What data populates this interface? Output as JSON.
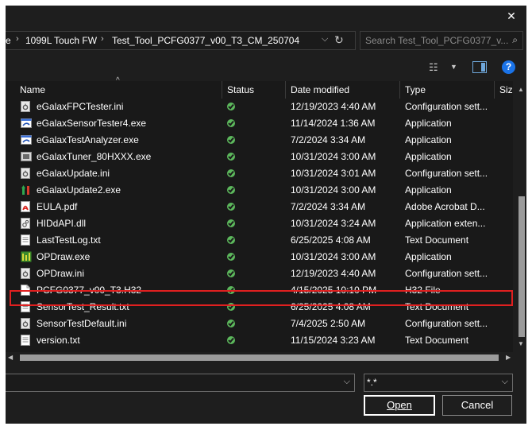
{
  "breadcrumb": [
    "e",
    "1099L Touch FW",
    "Test_Tool_PCFG0377_v00_T3_CM_250704"
  ],
  "search": {
    "placeholder": "Search Test_Tool_PCFG0377_v..."
  },
  "columns": {
    "name": "Name",
    "status": "Status",
    "date": "Date modified",
    "type": "Type",
    "size": "Siz"
  },
  "files": [
    {
      "name": "eGalaxFPCTester.ini",
      "date": "12/19/2023 4:40 AM",
      "type": "Configuration sett...",
      "icon": "ini-file-icon"
    },
    {
      "name": "eGalaxSensorTester4.exe",
      "date": "11/14/2024 1:36 AM",
      "type": "Application",
      "icon": "app-icon"
    },
    {
      "name": "eGalaxTestAnalyzer.exe",
      "date": "7/2/2024 3:34 AM",
      "type": "Application",
      "icon": "app-icon"
    },
    {
      "name": "eGalaxTuner_80HXXX.exe",
      "date": "10/31/2024 3:00 AM",
      "type": "Application",
      "icon": "tuner-app-icon"
    },
    {
      "name": "eGalaxUpdate.ini",
      "date": "10/31/2024 3:01 AM",
      "type": "Configuration sett...",
      "icon": "ini-file-icon"
    },
    {
      "name": "eGalaxUpdate2.exe",
      "date": "10/31/2024 3:00 AM",
      "type": "Application",
      "icon": "update-app-icon"
    },
    {
      "name": "EULA.pdf",
      "date": "7/2/2024 3:34 AM",
      "type": "Adobe Acrobat D...",
      "icon": "pdf-icon"
    },
    {
      "name": "HIDdAPI.dll",
      "date": "10/31/2024 3:24 AM",
      "type": "Application exten...",
      "icon": "dll-icon"
    },
    {
      "name": "LastTestLog.txt",
      "date": "6/25/2025 4:08 AM",
      "type": "Text Document",
      "icon": "text-file-icon"
    },
    {
      "name": "OPDraw.exe",
      "date": "10/31/2024 3:00 AM",
      "type": "Application",
      "icon": "opdraw-app-icon"
    },
    {
      "name": "OPDraw.ini",
      "date": "12/19/2023 4:40 AM",
      "type": "Configuration sett...",
      "icon": "ini-file-icon"
    },
    {
      "name": "PCFG0377_v00_T3.H32",
      "date": "4/15/2025 10:10 PM",
      "type": "H32 File",
      "icon": "blank-file-icon"
    },
    {
      "name": "SensorTest_Result.txt",
      "date": "6/25/2025 4:08 AM",
      "type": "Text Document",
      "icon": "text-file-icon"
    },
    {
      "name": "SensorTestDefault.ini",
      "date": "7/4/2025 2:50 AM",
      "type": "Configuration sett...",
      "icon": "ini-file-icon"
    },
    {
      "name": "version.txt",
      "date": "11/15/2024 3:23 AM",
      "type": "Text Document",
      "icon": "text-file-icon"
    }
  ],
  "filter": {
    "value": "*.*"
  },
  "buttons": {
    "open": "Open",
    "cancel": "Cancel"
  },
  "colors": {
    "background": "#1e1e1e",
    "status_ok": "#5cb85c",
    "highlight": "#e02020",
    "help": "#1a73e8"
  }
}
